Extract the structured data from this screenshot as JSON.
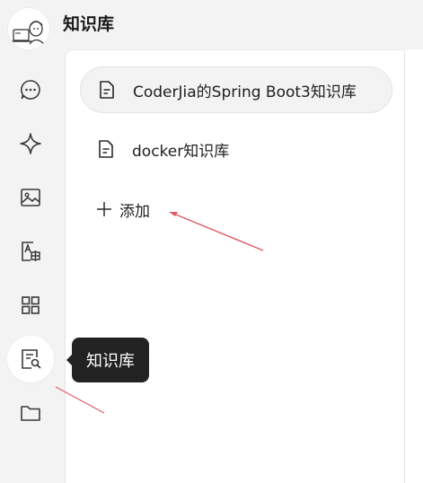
{
  "header": {
    "title": "知识库"
  },
  "rail": {
    "items": [
      {
        "icon": "chat-icon"
      },
      {
        "icon": "sparkle-icon"
      },
      {
        "icon": "image-icon"
      },
      {
        "icon": "translate-icon"
      },
      {
        "icon": "apps-grid-icon"
      },
      {
        "icon": "knowledge-search-icon",
        "active": true
      },
      {
        "icon": "folder-icon"
      }
    ]
  },
  "knowledge_bases": [
    {
      "label": "CoderJia的Spring Boot3知识库",
      "selected": true
    },
    {
      "label": "docker知识库",
      "selected": false
    }
  ],
  "add": {
    "label": "添加"
  },
  "tooltip": {
    "text": "知识库"
  },
  "colors": {
    "background": "#f3f3f3",
    "panel": "#ffffff",
    "tooltip": "#222222",
    "annotation_arrow": "#e05a66"
  }
}
